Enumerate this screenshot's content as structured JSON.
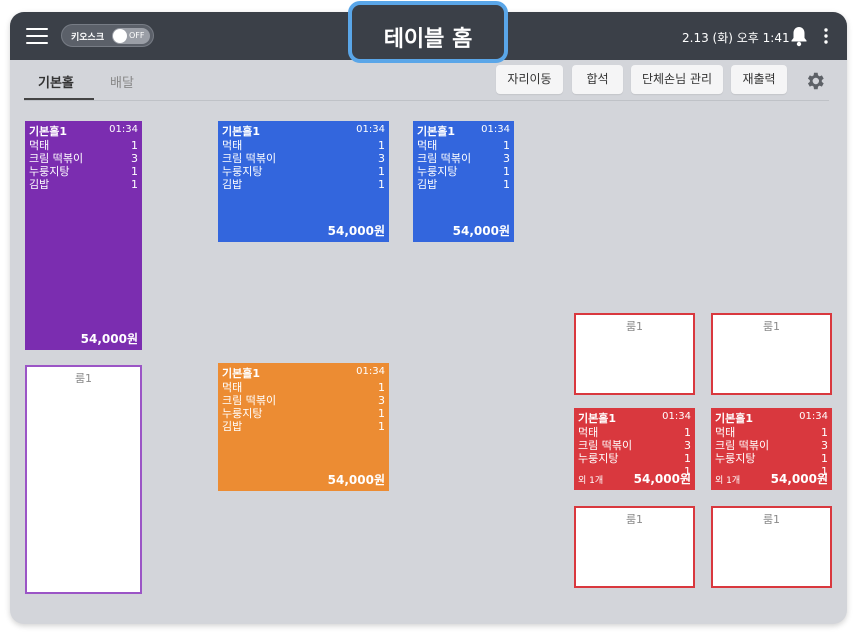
{
  "header": {
    "kiosk_label": "키오스크",
    "kiosk_state": "OFF",
    "title": "테이블 홈",
    "datetime": "2.13 (화) 오후 1:41"
  },
  "tabs": [
    {
      "label": "기본홀",
      "active": true
    },
    {
      "label": "배달",
      "active": false
    }
  ],
  "actions": [
    "자리이동",
    "합석",
    "단체손님 관리",
    "재출력"
  ],
  "colors": {
    "topbar": "#3b4048",
    "purple": "#7b2db0",
    "blue": "#3366dd",
    "orange": "#ec8c33",
    "red": "#d9383e",
    "empty_purple_border": "#9b55c6",
    "empty_red_border": "#d9383e"
  },
  "occupied": {
    "name": "기본홀1",
    "time": "01:34",
    "items": [
      {
        "name": "먹태",
        "qty": "1"
      },
      {
        "name": "크림 떡볶이",
        "qty": "3"
      },
      {
        "name": "누룽지탕",
        "qty": "1"
      },
      {
        "name": "김밥",
        "qty": "1"
      }
    ],
    "total": "54,000원",
    "more": "외 1개"
  },
  "room_label": "룸1"
}
